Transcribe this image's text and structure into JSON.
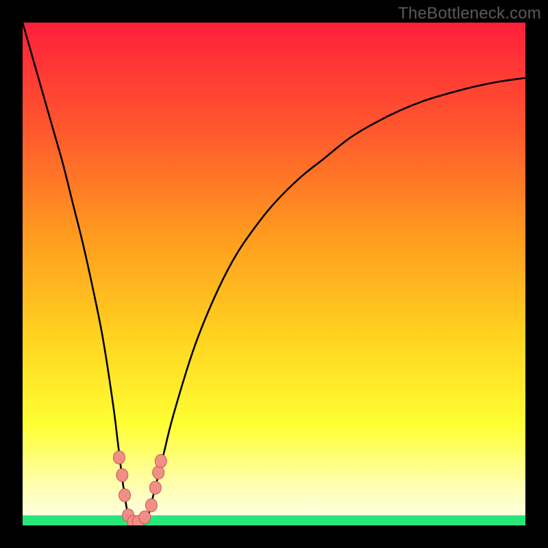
{
  "watermark": "TheBottleneck.com",
  "colors": {
    "frame": "#000000",
    "gradient_top": "#ff1f3a",
    "gradient_mid1": "#ff5a2d",
    "gradient_mid2": "#ff9a1f",
    "gradient_mid3": "#ffd21f",
    "gradient_mid4": "#ffff33",
    "gradient_pale": "#ffffb0",
    "gradient_green": "#28e77a",
    "curve": "#000000",
    "marker_fill": "#ef8f86",
    "marker_stroke": "#c9574f"
  },
  "chart_data": {
    "type": "line",
    "title": "",
    "xlabel": "",
    "ylabel": "",
    "xlim": [
      0,
      100
    ],
    "ylim": [
      0,
      100
    ],
    "series": [
      {
        "name": "bottleneck-curve",
        "x": [
          0,
          2,
          4,
          6,
          8,
          10,
          12,
          14,
          16,
          18,
          19,
          20,
          21,
          22,
          23,
          24,
          25,
          26,
          28,
          30,
          34,
          38,
          42,
          46,
          50,
          55,
          60,
          65,
          70,
          75,
          80,
          85,
          90,
          95,
          100
        ],
        "y": [
          100,
          93,
          86,
          79,
          72,
          64,
          56,
          47,
          37,
          24,
          16,
          8,
          2,
          0.5,
          0.5,
          0.5,
          2,
          6,
          14,
          22,
          35,
          45,
          53,
          59,
          64,
          69,
          73,
          77,
          80,
          82.5,
          84.5,
          86,
          87.3,
          88.3,
          89
        ]
      }
    ],
    "markers": [
      {
        "x": 19.2,
        "y": 13.5
      },
      {
        "x": 19.8,
        "y": 10.0
      },
      {
        "x": 20.3,
        "y": 6.0
      },
      {
        "x": 21.0,
        "y": 2.0
      },
      {
        "x": 22.0,
        "y": 0.7
      },
      {
        "x": 23.0,
        "y": 0.7
      },
      {
        "x": 24.3,
        "y": 1.6
      },
      {
        "x": 25.6,
        "y": 4.0
      },
      {
        "x": 26.4,
        "y": 7.5
      },
      {
        "x": 27.0,
        "y": 10.5
      },
      {
        "x": 27.5,
        "y": 12.8
      }
    ],
    "green_band_y": 2.0
  }
}
